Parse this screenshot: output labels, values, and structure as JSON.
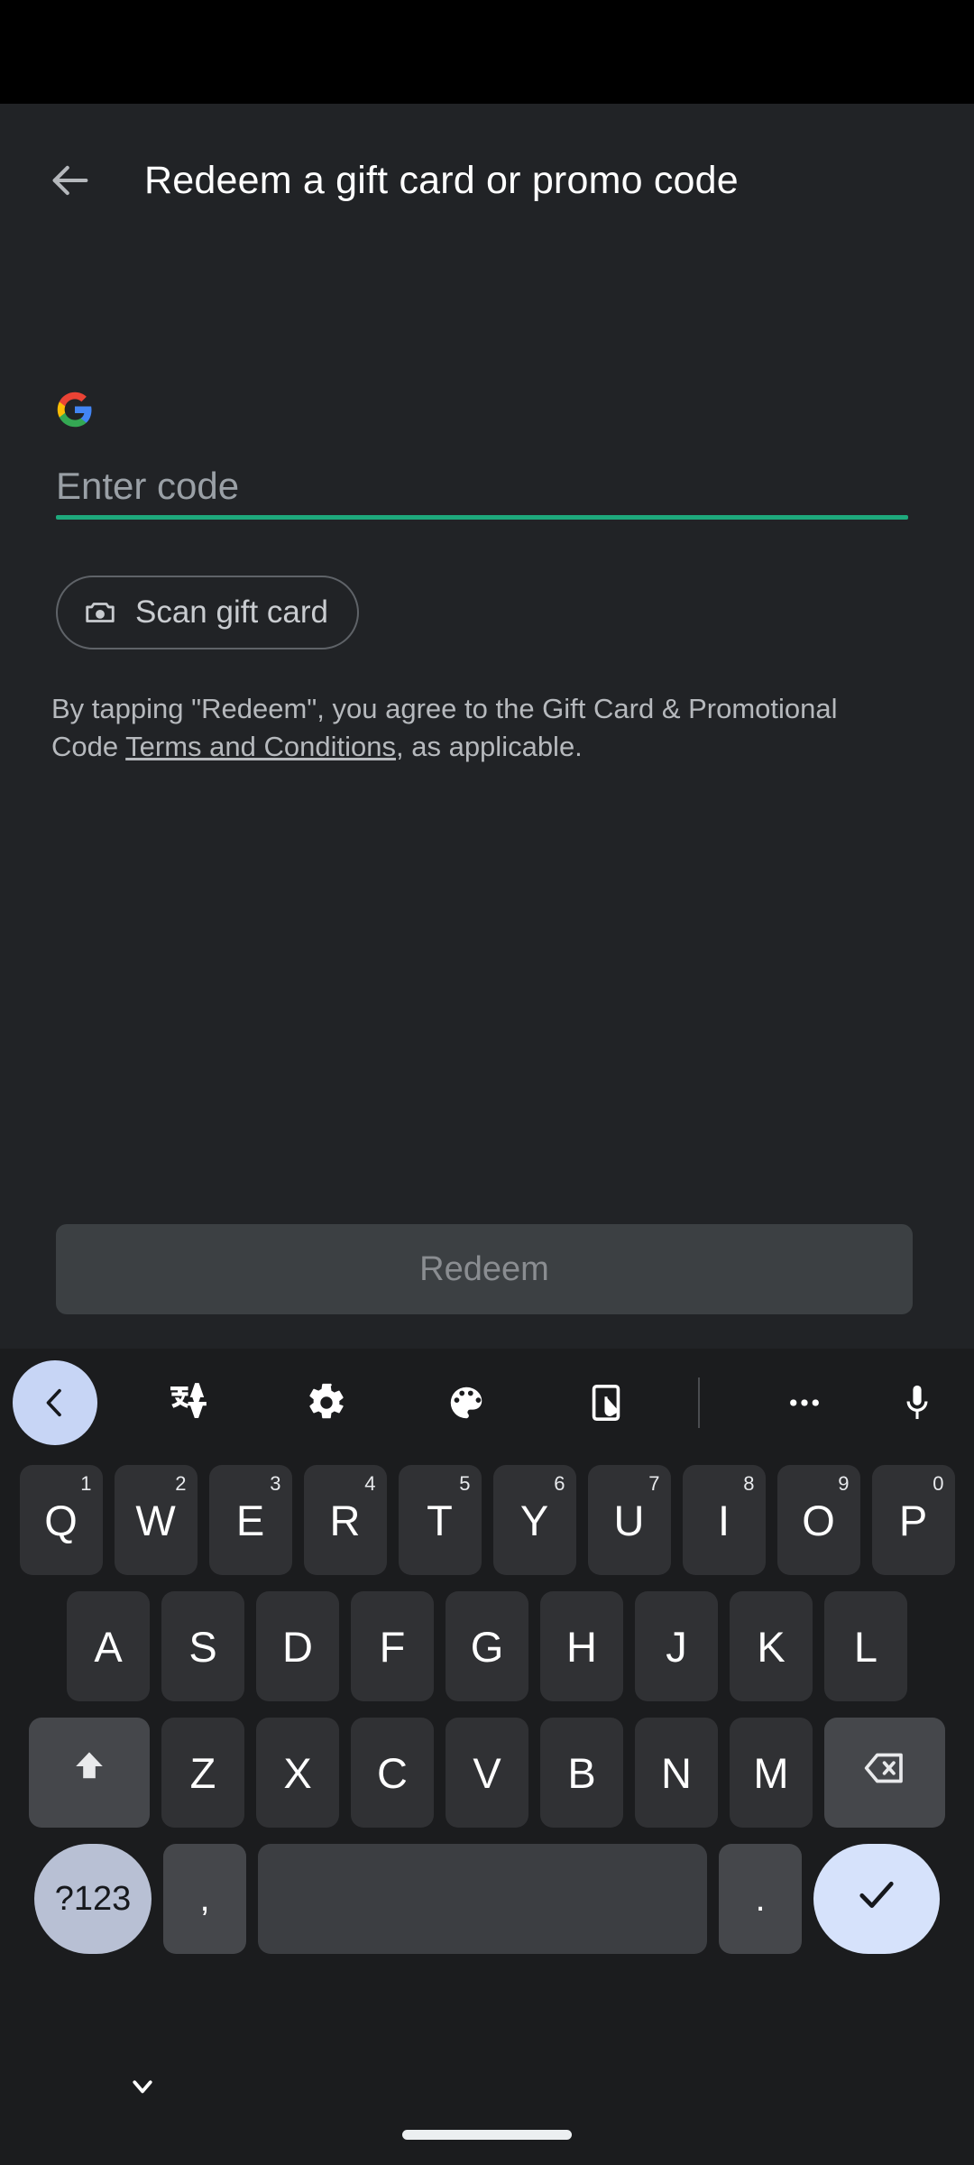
{
  "statusbar": {
    "empty": ""
  },
  "header": {
    "back_icon": "arrow-left-icon",
    "title": "Redeem a gift card or promo code"
  },
  "brand": {
    "logo_icon": "google-g-logo",
    "colors": {
      "blue": "#4285F4",
      "red": "#EA4335",
      "yellow": "#FBBC05",
      "green": "#34A853"
    }
  },
  "form": {
    "code_input": {
      "value": "",
      "placeholder": "Enter code",
      "underline_color": "#1ea97c"
    },
    "scan_button": {
      "label": "Scan gift card",
      "icon": "camera-icon"
    },
    "terms": {
      "before": "By tapping \"Redeem\", you agree to the Gift Card & Promotional Code ",
      "link": "Terms and Conditions",
      "after": ", as applicable."
    },
    "redeem_button": {
      "label": "Redeem",
      "enabled": false
    }
  },
  "keyboard": {
    "toolbar": [
      {
        "name": "keyboard-back-icon",
        "glyph": "chevron-left",
        "highlighted": true
      },
      {
        "name": "translate-icon",
        "glyph": "translate",
        "highlighted": false
      },
      {
        "name": "settings-gear-icon",
        "glyph": "gear",
        "highlighted": false
      },
      {
        "name": "theme-palette-icon",
        "glyph": "palette",
        "highlighted": false
      },
      {
        "name": "sticker-handwriting-icon",
        "glyph": "sticker",
        "highlighted": false
      },
      {
        "name": "more-options-icon",
        "glyph": "ellipsis",
        "highlighted": false
      },
      {
        "name": "voice-input-icon",
        "glyph": "microphone",
        "highlighted": false
      }
    ],
    "row1": [
      {
        "key": "Q",
        "sup": "1"
      },
      {
        "key": "W",
        "sup": "2"
      },
      {
        "key": "E",
        "sup": "3"
      },
      {
        "key": "R",
        "sup": "4"
      },
      {
        "key": "T",
        "sup": "5"
      },
      {
        "key": "Y",
        "sup": "6"
      },
      {
        "key": "U",
        "sup": "7"
      },
      {
        "key": "I",
        "sup": "8"
      },
      {
        "key": "O",
        "sup": "9"
      },
      {
        "key": "P",
        "sup": "0"
      }
    ],
    "row2": [
      {
        "key": "A"
      },
      {
        "key": "S"
      },
      {
        "key": "D"
      },
      {
        "key": "F"
      },
      {
        "key": "G"
      },
      {
        "key": "H"
      },
      {
        "key": "J"
      },
      {
        "key": "K"
      },
      {
        "key": "L"
      }
    ],
    "row3": [
      {
        "key": "Z"
      },
      {
        "key": "X"
      },
      {
        "key": "C"
      },
      {
        "key": "V"
      },
      {
        "key": "B"
      },
      {
        "key": "N"
      },
      {
        "key": "M"
      }
    ],
    "shift": {
      "label": "",
      "icon": "shift-arrow-icon"
    },
    "backspace": {
      "label": "",
      "icon": "backspace-icon"
    },
    "row4": {
      "symbols": "?123",
      "comma": ",",
      "space": "",
      "period": ".",
      "enter_icon": "checkmark-icon"
    }
  },
  "navbar": {
    "hide_keyboard_icon": "chevron-down-icon",
    "home_indicator": "home-indicator"
  }
}
